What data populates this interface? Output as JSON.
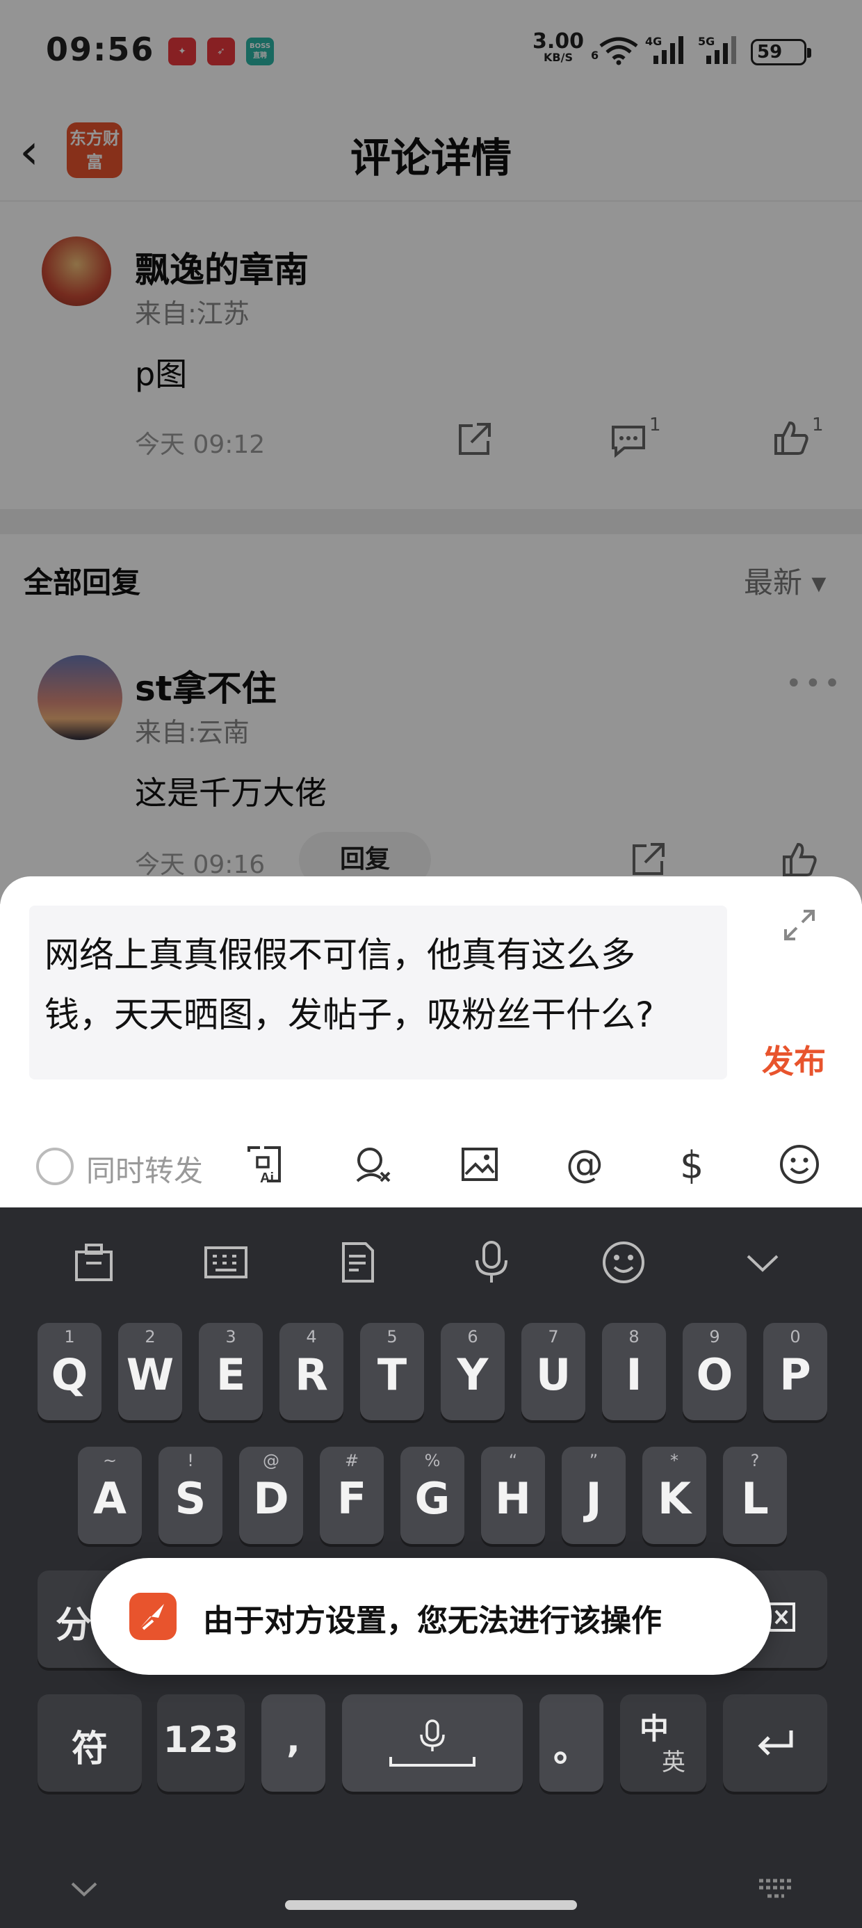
{
  "status_bar": {
    "time": "09:56",
    "net_speed": "3.00",
    "net_unit": "KB/S",
    "wifi_num": "6",
    "sig1": "4G",
    "sig2": "5G",
    "battery": "59",
    "app_boss": "BOSS直聘"
  },
  "nav": {
    "logo": "东方财富",
    "title": "评论详情"
  },
  "main_comment": {
    "author": "飘逸的章南",
    "location": "来自:江苏",
    "content": "p图",
    "time": "今天 09:12",
    "comment_count": "1",
    "like_count": "1"
  },
  "replies_section": {
    "title": "全部回复",
    "sort": "最新 ▾"
  },
  "reply": {
    "author": "st拿不住",
    "location": "来自:云南",
    "content": "这是千万大佬",
    "time": "今天 09:16",
    "reply_label": "回复",
    "more": "•••"
  },
  "compose": {
    "text_line1": "网络上真真假假不可信，他真有这么多",
    "text_line2": "钱，天天晒图，发帖子，吸粉丝干什么?",
    "publish": "发布",
    "forward_label": "同时转发"
  },
  "keyboard": {
    "row1": [
      {
        "sub": "1",
        "main": "Q"
      },
      {
        "sub": "2",
        "main": "W"
      },
      {
        "sub": "3",
        "main": "E"
      },
      {
        "sub": "4",
        "main": "R"
      },
      {
        "sub": "5",
        "main": "T"
      },
      {
        "sub": "6",
        "main": "Y"
      },
      {
        "sub": "7",
        "main": "U"
      },
      {
        "sub": "8",
        "main": "I"
      },
      {
        "sub": "9",
        "main": "O"
      },
      {
        "sub": "0",
        "main": "P"
      }
    ],
    "row2": [
      {
        "sub": "~",
        "main": "A"
      },
      {
        "sub": "!",
        "main": "S"
      },
      {
        "sub": "@",
        "main": "D"
      },
      {
        "sub": "#",
        "main": "F"
      },
      {
        "sub": "%",
        "main": "G"
      },
      {
        "sub": "“",
        "main": "H"
      },
      {
        "sub": "”",
        "main": "J"
      },
      {
        "sub": "*",
        "main": "K"
      },
      {
        "sub": "?",
        "main": "L"
      }
    ],
    "split_key": "分",
    "symbols": "符",
    "numbers": "123",
    "comma": ",",
    "period": "。",
    "lang_top": "中",
    "lang_bottom": "英"
  },
  "toast": {
    "message": "由于对方设置，您无法进行该操作"
  }
}
